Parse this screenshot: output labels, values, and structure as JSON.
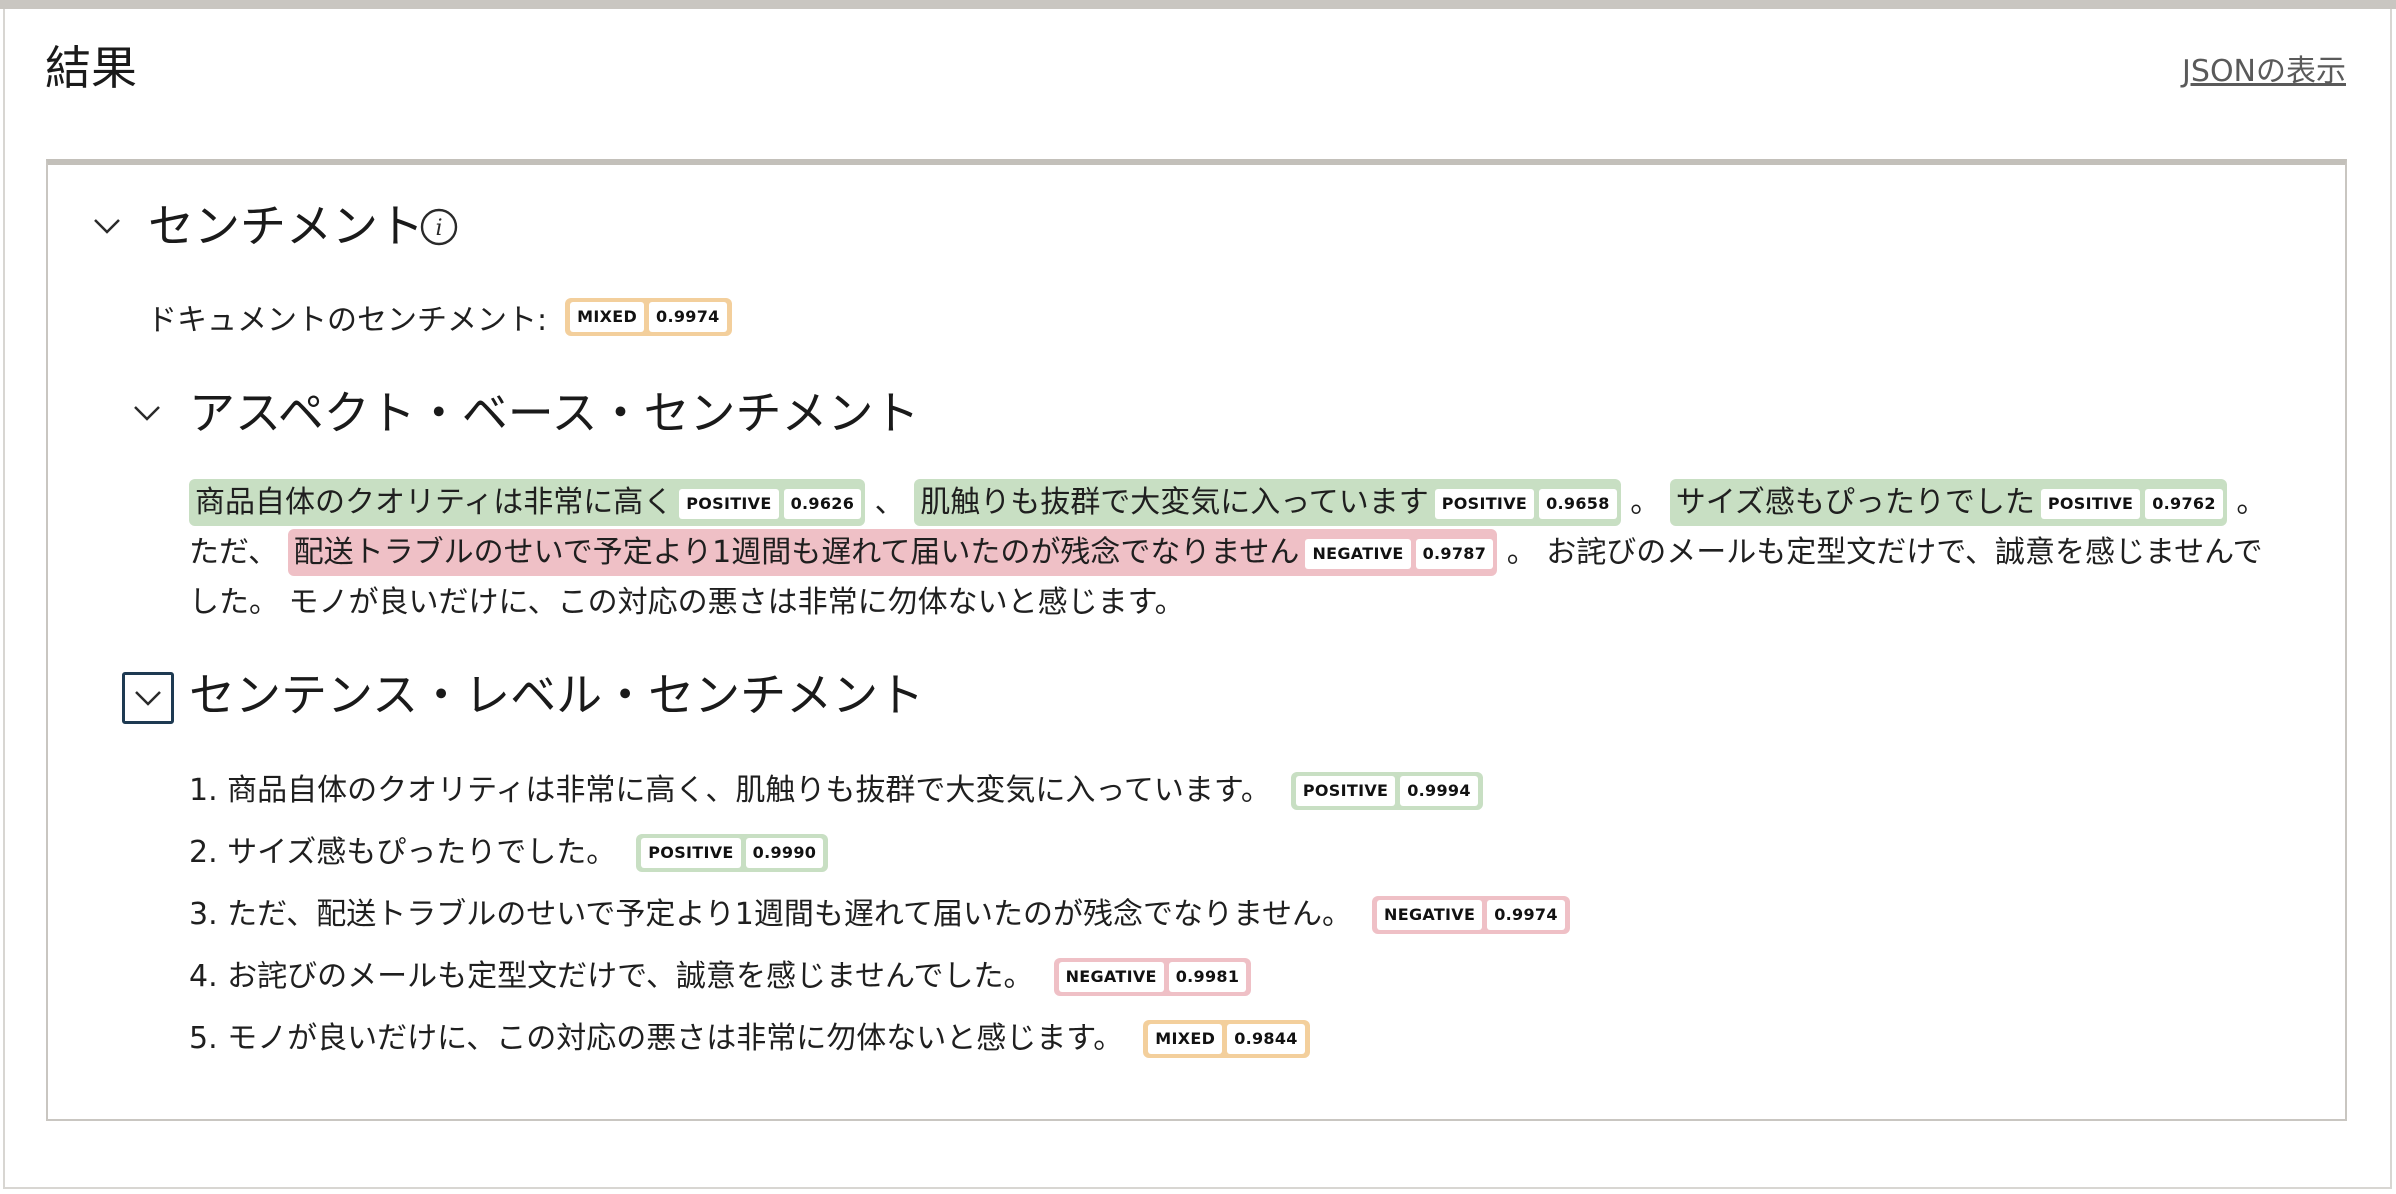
{
  "header": {
    "title": "結果",
    "json_link": "JSONの表示"
  },
  "sentiment": {
    "title": "センチメント",
    "info_glyph": "i",
    "document": {
      "label": "ドキュメントのセンチメント:",
      "badge_label": "MIXED",
      "score": "0.9974"
    },
    "aspect": {
      "title": "アスペクト・ベース・センチメント",
      "segments": [
        {
          "type": "span",
          "text": "商品自体のクオリティは非常に高く",
          "label": "POSITIVE",
          "score": "0.9626",
          "sentiment": "positive"
        },
        {
          "type": "text",
          "text": " 、 "
        },
        {
          "type": "span",
          "text": "肌触りも抜群で大変気に入っています",
          "label": "POSITIVE",
          "score": "0.9658",
          "sentiment": "positive"
        },
        {
          "type": "text",
          "text": " 。 "
        },
        {
          "type": "span",
          "text": "サイズ感もぴったりでした",
          "label": "POSITIVE",
          "score": "0.9762",
          "sentiment": "positive"
        },
        {
          "type": "text",
          "text": " 。 ただ、 "
        },
        {
          "type": "span",
          "text": "配送トラブルのせいで予定より1週間も遅れて届いたのが残念でなりません",
          "label": "NEGATIVE",
          "score": "0.9787",
          "sentiment": "negative"
        },
        {
          "type": "text",
          "text": " 。 お詫びのメールも定型文だけで、誠意を感じませんでした。 モノが良いだけに、この対応の悪さは非常に勿体ないと感じます。"
        }
      ]
    },
    "sentence": {
      "title": "センテンス・レベル・センチメント",
      "items": [
        {
          "text": "1. 商品自体のクオリティは非常に高く、肌触りも抜群で大変気に入っています。",
          "label": "POSITIVE",
          "score": "0.9994",
          "sentiment": "positive"
        },
        {
          "text": "2. サイズ感もぴったりでした。",
          "label": "POSITIVE",
          "score": "0.9990",
          "sentiment": "positive"
        },
        {
          "text": "3. ただ、配送トラブルのせいで予定より1週間も遅れて届いたのが残念でなりません。",
          "label": "NEGATIVE",
          "score": "0.9974",
          "sentiment": "negative"
        },
        {
          "text": "4. お詫びのメールも定型文だけで、誠意を感じませんでした。",
          "label": "NEGATIVE",
          "score": "0.9981",
          "sentiment": "negative"
        },
        {
          "text": "5. モノが良いだけに、この対応の悪さは非常に勿体ないと感じます。",
          "label": "MIXED",
          "score": "0.9844",
          "sentiment": "mixed"
        }
      ]
    }
  },
  "colors": {
    "positive": "#c8dfc3",
    "negative": "#efc0c6",
    "mixed": "#f3cf9c",
    "focus_ring": "#1e3a52"
  }
}
